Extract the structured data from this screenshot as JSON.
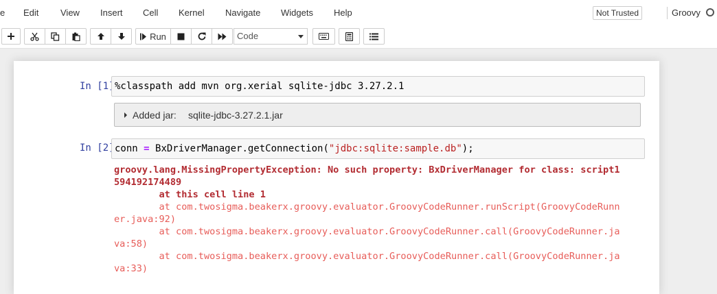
{
  "menubar": {
    "items": [
      "e",
      "Edit",
      "View",
      "Insert",
      "Cell",
      "Kernel",
      "Navigate",
      "Widgets",
      "Help"
    ],
    "trusted": "Not Trusted",
    "kernel": "Groovy"
  },
  "toolbar": {
    "buttons": [
      "plus-icon",
      "cut-icon",
      "copy-icon",
      "paste-icon",
      "arrow-up-icon",
      "arrow-down-icon",
      "run-icon",
      "stop-icon",
      "restart-icon",
      "fast-forward-icon",
      "keyboard-icon",
      "calculator-icon",
      "list-icon"
    ],
    "run_label": "Run",
    "cell_type": "Code"
  },
  "cells": [
    {
      "prompt": "In [1]:",
      "input": "%classpath add mvn org.xerial sqlite-jdbc 3.27.2.1",
      "output": {
        "label": "Added jar:",
        "value": "sqlite-jdbc-3.27.2.1.jar"
      }
    },
    {
      "prompt": "In [2]:",
      "input_tokens": {
        "a": "conn ",
        "op": "=",
        "b": " BxDriverManager.getConnection(",
        "str": "\"jdbc:sqlite:sample.db\"",
        "c": ");"
      },
      "error_lines": [
        {
          "text": "groovy.lang.MissingPropertyException: No such property: BxDriverManager for class: script1",
          "style": "bold"
        },
        {
          "text": "594192174489",
          "style": "bold"
        },
        {
          "text": "        at this cell line 1",
          "style": "bold"
        },
        {
          "text": "        at com.twosigma.beakerx.groovy.evaluator.GroovyCodeRunner.runScript(GroovyCodeRunn",
          "style": "light"
        },
        {
          "text": "er.java:92)",
          "style": "light"
        },
        {
          "text": "        at com.twosigma.beakerx.groovy.evaluator.GroovyCodeRunner.call(GroovyCodeRunner.ja",
          "style": "light"
        },
        {
          "text": "va:58)",
          "style": "light"
        },
        {
          "text": "        at com.twosigma.beakerx.groovy.evaluator.GroovyCodeRunner.call(GroovyCodeRunner.ja",
          "style": "light"
        },
        {
          "text": "va:33)",
          "style": "light"
        }
      ]
    }
  ]
}
